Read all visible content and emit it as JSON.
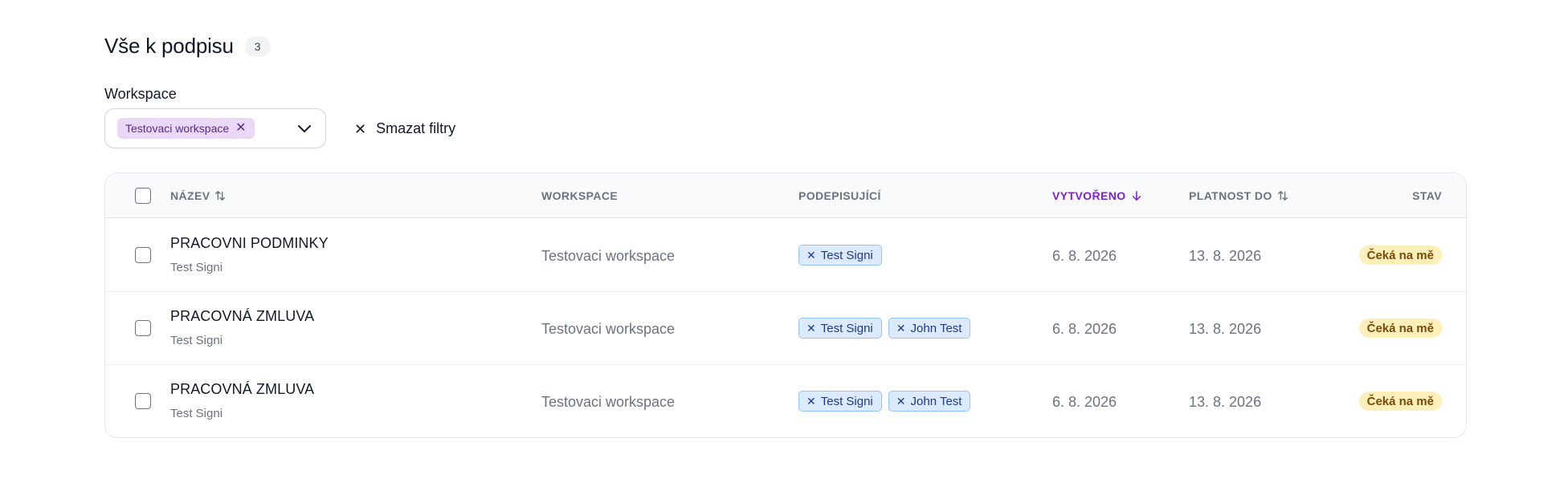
{
  "header": {
    "title": "Vše k podpisu",
    "count": "3"
  },
  "filters": {
    "label": "Workspace",
    "selected_chip": "Testovaci workspace",
    "chip_remove_glyph": "✕",
    "clear_glyph": "✕",
    "clear_label": "Smazat filtry"
  },
  "table": {
    "columns": {
      "name": "NÁZEV",
      "workspace": "WORKSPACE",
      "signers": "PODEPISUJÍCÍ",
      "created": "VYTVOŘENO",
      "valid_until": "PLATNOST DO",
      "status": "STAV"
    },
    "rows": [
      {
        "name": "PRACOVNI PODMINKY",
        "author": "Test Signi",
        "workspace": "Testovaci workspace",
        "signers": [
          "Test Signi"
        ],
        "created": "6. 8. 2026",
        "valid_until": "13. 8. 2026",
        "status": "Čeká na mě"
      },
      {
        "name": "PRACOVNÁ ZMLUVA",
        "author": "Test Signi",
        "workspace": "Testovaci workspace",
        "signers": [
          "Test Signi",
          "John Test"
        ],
        "created": "6. 8. 2026",
        "valid_until": "13. 8. 2026",
        "status": "Čeká na mě"
      },
      {
        "name": "PRACOVNÁ ZMLUVA",
        "author": "Test Signi",
        "workspace": "Testovaci workspace",
        "signers": [
          "Test Signi",
          "John Test"
        ],
        "created": "6. 8. 2026",
        "valid_until": "13. 8. 2026",
        "status": "Čeká na mě"
      }
    ],
    "signer_remove_glyph": "✕"
  },
  "icons": {
    "sort_both": "sort-arrows-icon",
    "sort_desc": "arrow-down-icon",
    "chevron": "chevron-down-icon",
    "close": "close-icon"
  },
  "colors": {
    "accent": "#7e22ce",
    "workspace_chip_bg": "#e9d9f7",
    "signer_chip_bg": "#dbeafe",
    "status_bg": "#fdefb9"
  }
}
